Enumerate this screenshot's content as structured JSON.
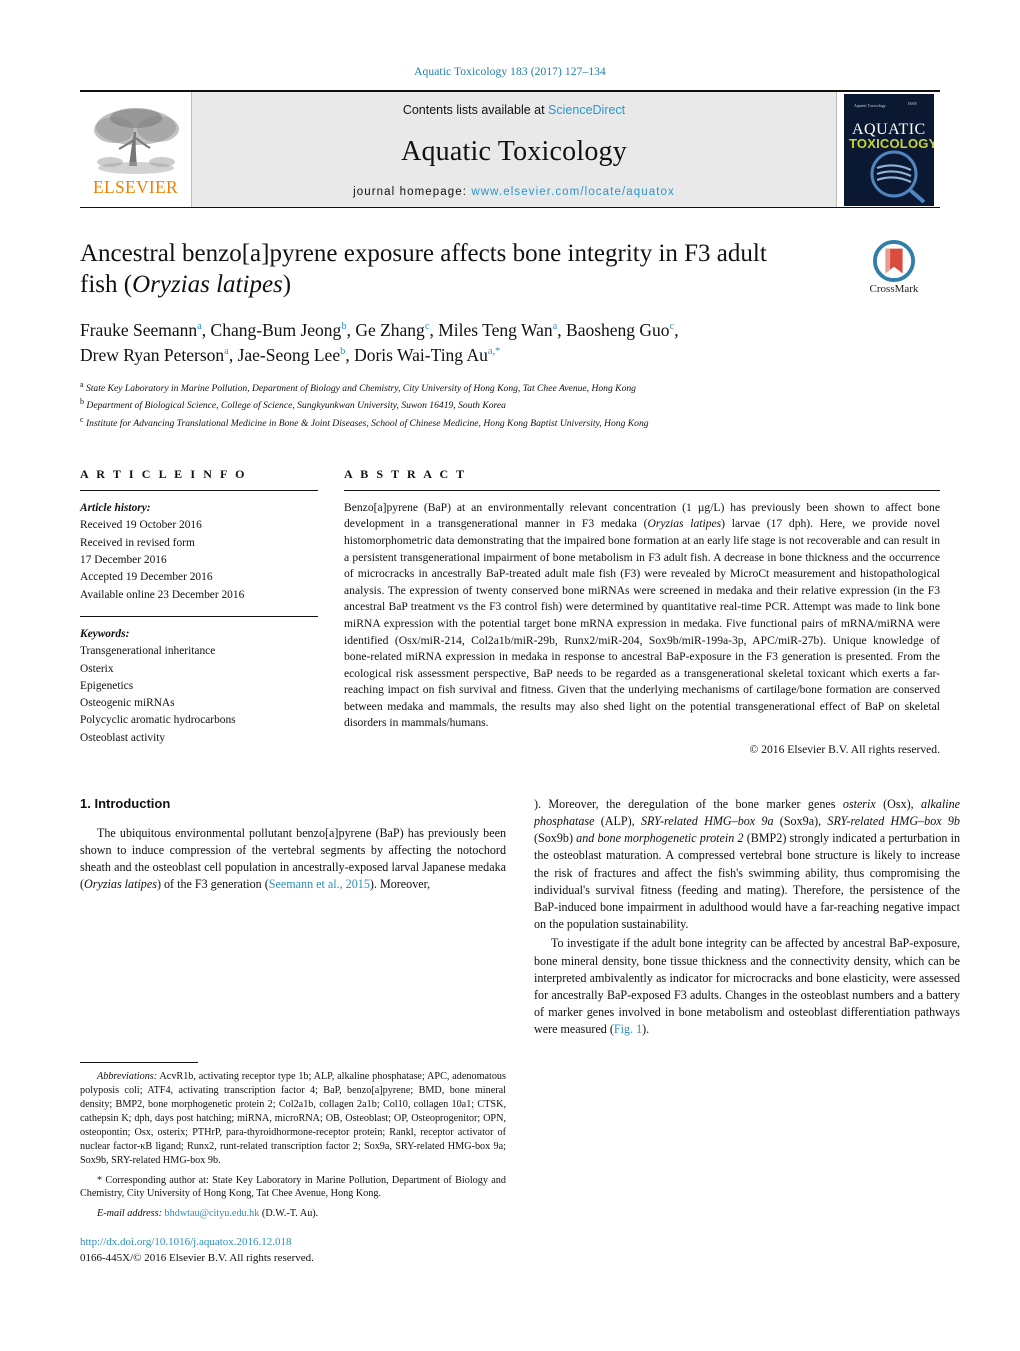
{
  "running_head": "Aquatic Toxicology 183 (2017) 127–134",
  "masthead": {
    "publisher_name": "ELSEVIER",
    "contents_prefix": "Contents lists available at ",
    "contents_link": "ScienceDirect",
    "journal_name": "Aquatic Toxicology",
    "homepage_prefix": "journal homepage: ",
    "homepage_url": "www.elsevier.com/locate/aquatox",
    "cover_title_line1": "AQUATIC",
    "cover_title_line2": "TOXICOLOGY"
  },
  "article": {
    "title_line1": "Ancestral benzo[a]pyrene exposure affects bone integrity in F3 adult",
    "title_line2_pre": "fish (",
    "title_species": "Oryzias latipes",
    "title_line2_post": ")",
    "crossmark_label": "CrossMark",
    "authors": [
      {
        "name": "Frauke Seemann",
        "sup": "a"
      },
      {
        "name": "Chang-Bum Jeong",
        "sup": "b"
      },
      {
        "name": "Ge Zhang",
        "sup": "c"
      },
      {
        "name": "Miles Teng Wan",
        "sup": "a"
      },
      {
        "name": "Baosheng Guo",
        "sup": "c"
      },
      {
        "name": "Drew Ryan Peterson",
        "sup": "a"
      },
      {
        "name": "Jae-Seong Lee",
        "sup": "b"
      },
      {
        "name": "Doris Wai-Ting Au",
        "sup": "a,*"
      }
    ],
    "affiliations": [
      {
        "marker": "a",
        "text": "State Key Laboratory in Marine Pollution, Department of Biology and Chemistry, City University of Hong Kong, Tat Chee Avenue, Hong Kong"
      },
      {
        "marker": "b",
        "text": "Department of Biological Science, College of Science, Sungkyunkwan University, Suwon 16419, South Korea"
      },
      {
        "marker": "c",
        "text": "Institute for Advancing Translational Medicine in Bone & Joint Diseases, School of Chinese Medicine, Hong Kong Baptist University, Hong Kong"
      }
    ]
  },
  "article_info": {
    "heading": "A R T I C L E   I N F O",
    "history_label": "Article history:",
    "history_lines": [
      "Received 19 October 2016",
      "Received in revised form",
      "17 December 2016",
      "Accepted 19 December 2016",
      "Available online 23 December 2016"
    ],
    "keywords_label": "Keywords:",
    "keywords": [
      "Transgenerational inheritance",
      "Osterix",
      "Epigenetics",
      "Osteogenic miRNAs",
      "Polycyclic aromatic hydrocarbons",
      "Osteoblast activity"
    ]
  },
  "abstract": {
    "heading": "A B S T R A C T",
    "body_part1": "Benzo[a]pyrene (BaP) at an environmentally relevant concentration (1 µg/L) has previously been shown to affect bone development in a transgenerational manner in F3 medaka (",
    "species": "Oryzias latipes",
    "body_part2": ") larvae (17 dph). Here, we provide novel histomorphometric data demonstrating that the impaired bone formation at an early life stage is not recoverable and can result in a persistent transgenerational impairment of bone metabolism in F3 adult fish. A decrease in bone thickness and the occurrence of microcracks in ancestrally BaP-treated adult male fish (F3) were revealed by MicroCt measurement and histopathological analysis. The expression of twenty conserved bone miRNAs were screened in medaka and their relative expression (in the F3 ancestral BaP treatment vs the F3 control fish) were determined by quantitative real-time PCR. Attempt was made to link bone miRNA expression with the potential target bone mRNA expression in medaka. Five functional pairs of mRNA/miRNA were identified (Osx/miR-214, Col2a1b/miR-29b, Runx2/miR-204, Sox9b/miR-199a-3p, APC/miR-27b). Unique knowledge of bone-related miRNA expression in medaka in response to ancestral BaP-exposure in the F3 generation is presented. From the ecological risk assessment perspective, BaP needs to be regarded as a transgenerational skeletal toxicant which exerts a far-reaching impact on fish survival and fitness. Given that the underlying mechanisms of cartilage/bone formation are conserved between medaka and mammals, the results may also shed light on the potential transgenerational effect of BaP on skeletal disorders in mammals/humans.",
    "copyright": "© 2016 Elsevier B.V. All rights reserved."
  },
  "introduction": {
    "heading": "1.  Introduction",
    "para1_pre": "The ubiquitous environmental pollutant benzo[a]pyrene (BaP) has previously been shown to induce compression of the vertebral segments by affecting the notochord sheath and the osteoblast cell population in ancestrally-exposed larval Japanese medaka (",
    "para1_species": "Oryzias latipes",
    "para1_mid": ") of the F3 generation (",
    "para1_citation": "Seemann et al., 2015",
    "para1_post": "). Moreover, the deregulation of the bone marker genes ",
    "p1_g1": "osterix",
    "p1_t1": " (Osx), ",
    "p1_g2": "alkaline phosphatase",
    "p1_t2": " (ALP), ",
    "p1_g3": "SRY-related HMG–box 9a",
    "p1_t3": " (Sox9a), ",
    "p1_g4": "SRY-related HMG–box 9b",
    "p1_t4": " (Sox9b) ",
    "p1_g5": "and bone morphogenetic protein 2",
    "p1_t5": " (BMP2) strongly indicated a perturbation in the osteoblast maturation. A compressed vertebral bone structure is likely to increase the risk of fractures and affect the fish's swimming ability, thus compromising the individual's survival fitness (feeding and mating). Therefore, the persistence of the BaP-induced bone impairment in adulthood would have a far-reaching negative impact on the population sustainability.",
    "para2_pre": "To investigate if the adult bone integrity can be affected by ancestral BaP-exposure, bone mineral density, bone tissue thickness and the connectivity density, which can be interpreted ambivalently as indicator for microcracks and bone elasticity, were assessed for ancestrally BaP-exposed F3 adults. Changes in the osteoblast numbers and a battery of marker genes involved in bone metabolism and osteoblast differentiation pathways were measured (",
    "para2_figref": "Fig. 1",
    "para2_post": ")."
  },
  "footnotes": {
    "abbrev_label": "Abbreviations:",
    "abbrev_text": " AcvR1b, activating receptor type 1b; ALP, alkaline phosphatase; APC, adenomatous polyposis coli; ATF4, activating transcription factor 4; BaP, benzo[a]pyrene; BMD, bone mineral density; BMP2, bone morphogenetic protein 2; Col2a1b, collagen 2a1b; Col10, collagen 10a1; CTSK, cathepsin K; dph, days post hatching; miRNA, microRNA; OB, Osteoblast; OP, Osteoprogenitor; OPN, osteopontin; Osx, osterix; PTHrP, para-thyroidhormone-receptor protein; Rankl, receptor activator of nuclear factor-κB ligand; Runx2, runt-related transcription factor 2; Sox9a, SRY-related HMG-box 9a; Sox9b, SRY-related HMG-box 9b.",
    "corresponding": "* Corresponding author at: State Key Laboratory in Marine Pollution, Department of Biology and Chemistry, City University of Hong Kong, Tat Chee Avenue, Hong Kong.",
    "email_label": "E-mail address:",
    "email_address": " bhdwtau@cityu.edu.hk",
    "email_suffix": " (D.W.-T. Au).",
    "doi": "http://dx.doi.org/10.1016/j.aquatox.2016.12.018",
    "issn_line": "0166-445X/© 2016 Elsevier B.V. All rights reserved."
  },
  "colors": {
    "link_blue": "#2c8fba",
    "elsevier_orange": "#F08000",
    "masthead_grey": "#e9e9e9"
  }
}
